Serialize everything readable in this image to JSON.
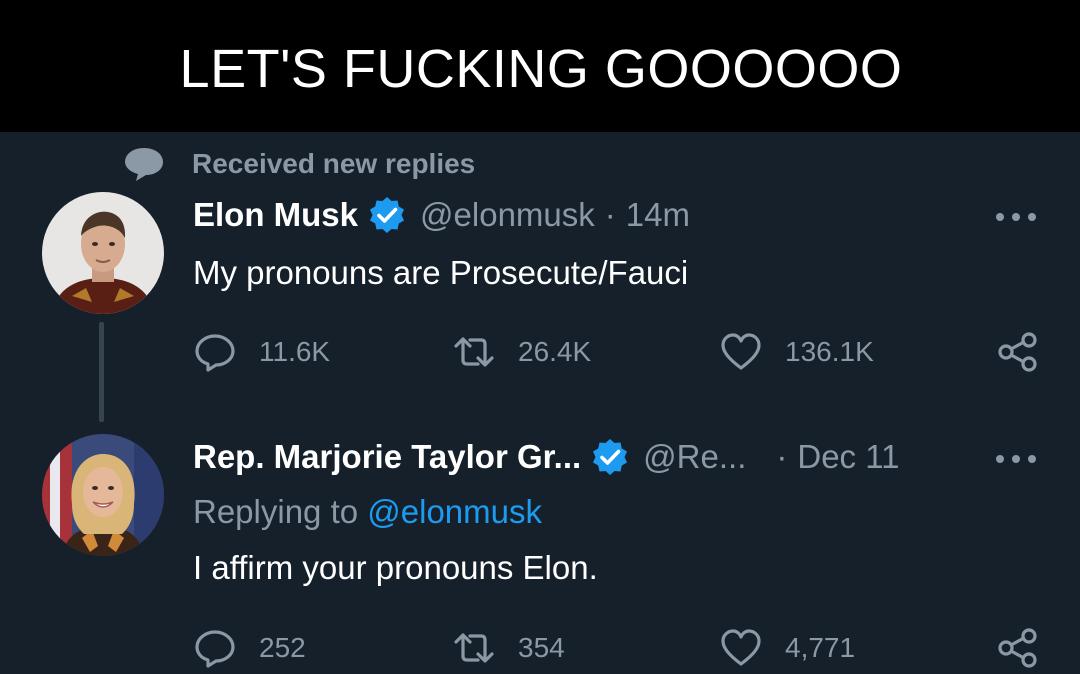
{
  "caption": "LET'S FUCKING GOOOOOO",
  "notice": {
    "text": "Received new replies",
    "icon": "speech-bubble-icon"
  },
  "tweets": [
    {
      "name": "Elon Musk",
      "handle": "@elonmusk",
      "separator": "·",
      "time": "14m",
      "text": "My pronouns are Prosecute/Fauci",
      "verified": true,
      "stats": {
        "replies": "11.6K",
        "retweets": "26.4K",
        "likes": "136.1K"
      }
    },
    {
      "name": "Rep. Marjorie Taylor Gr...",
      "handle": "@Re...",
      "separator": "·",
      "time": "Dec 11",
      "replying_prefix": "Replying to ",
      "replying_to": "@elonmusk",
      "text": "I affirm your pronouns Elon.",
      "verified": true,
      "stats": {
        "replies": "252",
        "retweets": "354",
        "likes": "4,771"
      }
    }
  ],
  "colors": {
    "background": "#15202b",
    "caption_bg": "#000000",
    "secondary_text": "#8b98a5",
    "accent_blue": "#1d9bf0",
    "thread_line": "#38444d"
  }
}
